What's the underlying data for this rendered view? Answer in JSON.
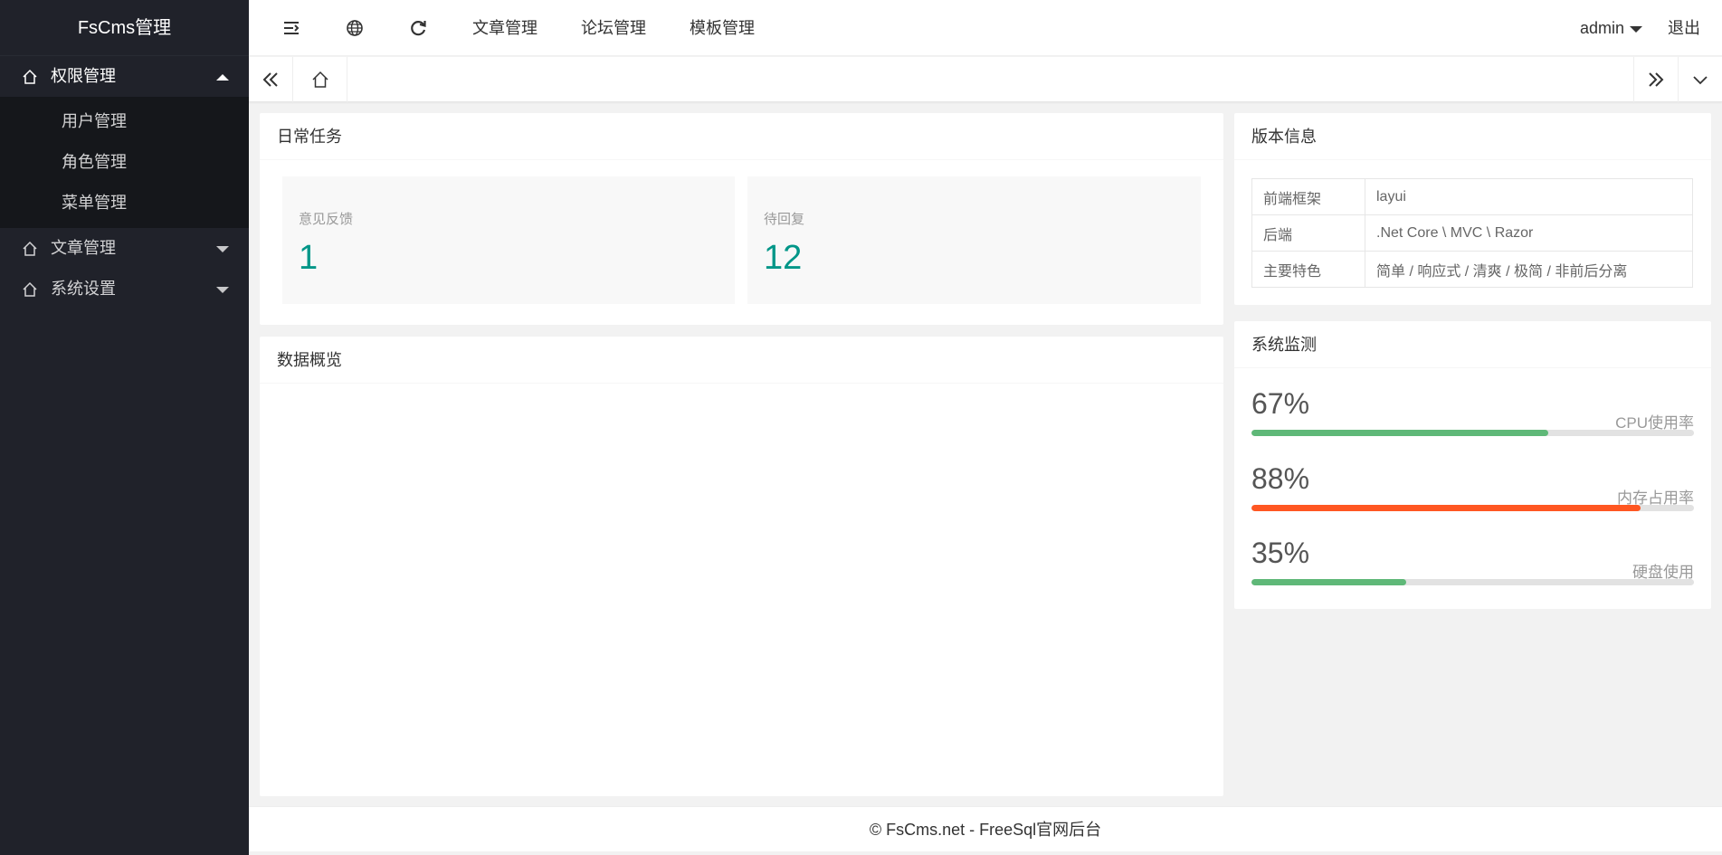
{
  "sidebar": {
    "logo": "FsCms管理",
    "menu": [
      {
        "label": "权限管理",
        "expanded": true,
        "children": [
          "用户管理",
          "角色管理",
          "菜单管理"
        ]
      },
      {
        "label": "文章管理",
        "expanded": false
      },
      {
        "label": "系统设置",
        "expanded": false
      }
    ]
  },
  "header": {
    "icons": [
      "menu-fold-icon",
      "globe-icon",
      "refresh-icon"
    ],
    "links": [
      "文章管理",
      "论坛管理",
      "模板管理"
    ],
    "user": "admin",
    "logout": "退出"
  },
  "tabs": {
    "icons": [
      "double-left-icon",
      "home-icon",
      "double-right-icon",
      "chevron-down-icon"
    ]
  },
  "daily_tasks": {
    "title": "日常任务",
    "items": [
      {
        "label": "意见反馈",
        "value": "1"
      },
      {
        "label": "待回复",
        "value": "12"
      }
    ]
  },
  "data_overview": {
    "title": "数据概览"
  },
  "version_info": {
    "title": "版本信息",
    "rows": [
      {
        "key": "前端框架",
        "value": "layui"
      },
      {
        "key": "后端",
        "value": ".Net Core \\ MVC \\ Razor"
      },
      {
        "key": "主要特色",
        "value": "简单 / 响应式 / 清爽 / 极简 / 非前后分离"
      }
    ]
  },
  "system_monitor": {
    "title": "系统监测",
    "items": [
      {
        "percent": "67%",
        "label": "CPU使用率",
        "value": 0.67,
        "color": "#5fb878"
      },
      {
        "percent": "88%",
        "label": "内存占用率",
        "value": 0.88,
        "color": "#ff5722"
      },
      {
        "percent": "35%",
        "label": "硬盘使用",
        "value": 0.35,
        "color": "#5fb878"
      }
    ]
  },
  "footer": {
    "text": "© FsCms.net - FreeSql官网后台"
  },
  "colors": {
    "sidebar_bg": "#20222a",
    "submenu_bg": "#15171b",
    "accent": "#009688"
  }
}
